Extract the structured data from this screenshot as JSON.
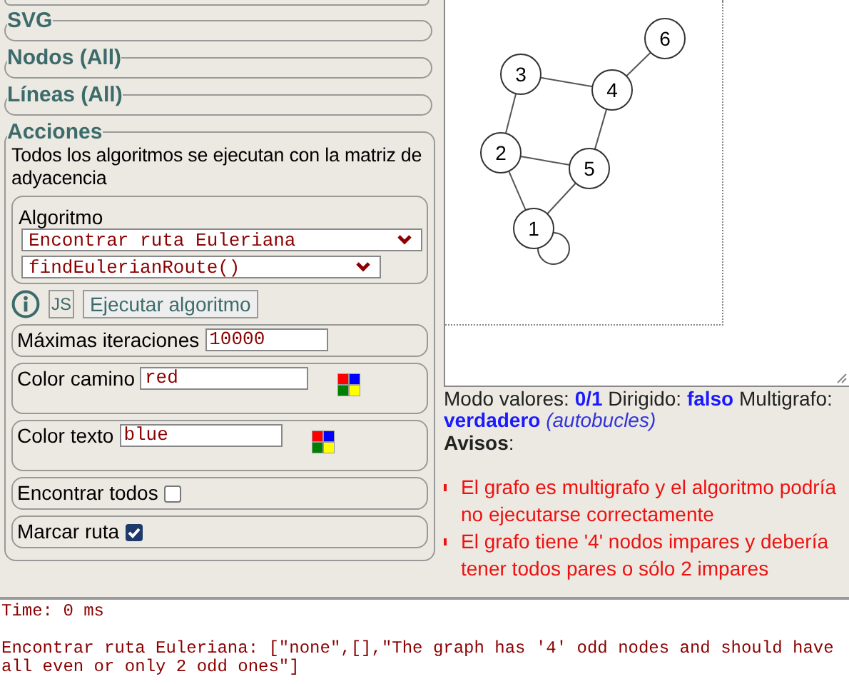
{
  "sections": [
    {
      "legend": "SVG",
      "expanded": false
    },
    {
      "legend": "Nodos (All)",
      "expanded": false
    },
    {
      "legend": "Líneas (All)",
      "expanded": false
    },
    {
      "legend": "Acciones",
      "expanded": true
    }
  ],
  "actions": {
    "description": "Todos los algoritmos se ejecutan con la matriz de adyacencia",
    "algorithm": {
      "legend": "Algoritmo",
      "name_select": "Encontrar ruta Euleriana",
      "function_select": "findEulerianRoute()"
    },
    "js_badge": "JS",
    "run_button": "Ejecutar algoritmo",
    "options": [
      {
        "kind": "number",
        "label": "Máximas iteraciones",
        "value": "10000"
      },
      {
        "kind": "color",
        "label": "Color camino",
        "value": "red"
      },
      {
        "kind": "color",
        "label": "Color texto",
        "value": "blue"
      },
      {
        "kind": "checkbox",
        "label": "Encontrar todos",
        "checked": false
      },
      {
        "kind": "checkbox",
        "label": "Marcar ruta",
        "checked": true
      }
    ]
  },
  "graph": {
    "nodes": [
      "1",
      "2",
      "3",
      "4",
      "5",
      "6"
    ]
  },
  "status": {
    "summary": "Modo valores: **0/1** Dirigido: **falso** Multigrafo: **verdadero** *(autobucles)*",
    "warnings_title": "**Avisos**:",
    "warnings": [
      "El grafo es multigrafo y el algoritmo podría no ejecutarse correctamente",
      "El grafo tiene '4' nodos impares y debería tener todos pares o sólo 2 impares"
    ]
  },
  "output": {
    "lines": [
      "Time: 0 ms",
      "Encontrar ruta Euleriana: [\"none\",[],\"The graph has '4' odd nodes and should have all even or only 2 odd ones\"]"
    ]
  }
}
